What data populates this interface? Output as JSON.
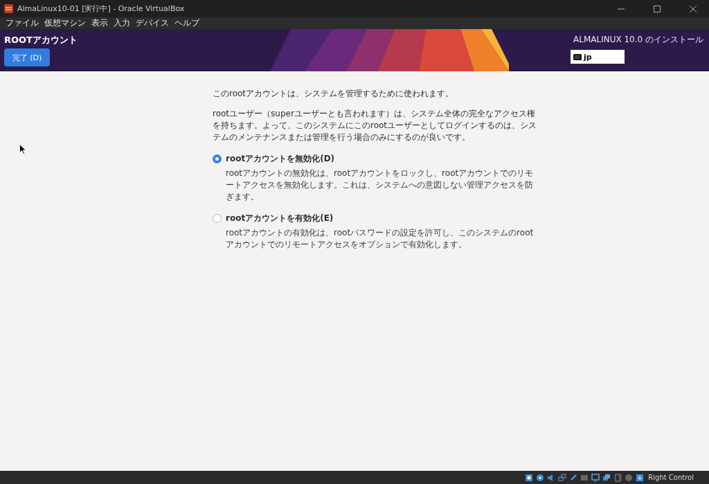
{
  "window": {
    "title": "AlmaLinux10-01 [実行中] - Oracle VirtualBox"
  },
  "menu": [
    "ファイル",
    "仮想マシン",
    "表示",
    "入力",
    "デバイス",
    "ヘルプ"
  ],
  "header": {
    "title": "ROOTアカウント",
    "done_button": "完了 (D)",
    "product": "ALMALINUX 10.0 のインストール",
    "keyboard_layout": "jp"
  },
  "intro": [
    "このrootアカウントは、システムを管理するために使われます。",
    "rootユーザー（superユーザーとも言われます）は、システム全体の完全なアクセス権を持ちます。よって、このシステムにこのrootユーザーとしてログインするのは、システムのメンテナンスまたは管理を行う場合のみにするのが良いです。"
  ],
  "options": [
    {
      "label": "rootアカウントを無効化(D)",
      "description": "rootアカウントの無効化は、rootアカウントをロックし、rootアカウントでのリモートアクセスを無効化します。これは、システムへの意図しない管理アクセスを防ぎます。",
      "selected": true
    },
    {
      "label": "rootアカウントを有効化(E)",
      "description": "rootアカウントの有効化は、rootパスワードの設定を許可し、このシステムのrootアカウントでのリモートアクセスをオプションで有効化します。",
      "selected": false
    }
  ],
  "status_bar": {
    "host_key": "Right Control"
  }
}
